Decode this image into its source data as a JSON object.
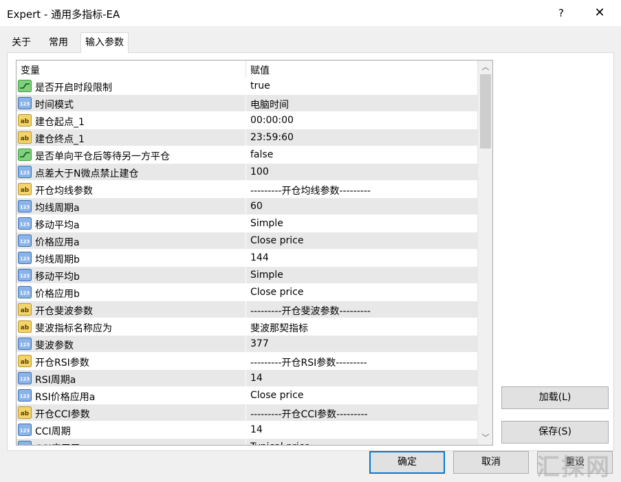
{
  "window": {
    "title": "Expert - 通用多指标-EA",
    "help_label": "?",
    "close_label": "✕"
  },
  "tabs": [
    {
      "label": "关于"
    },
    {
      "label": "常用"
    },
    {
      "label": "输入参数"
    }
  ],
  "grid": {
    "header_var": "变量",
    "header_val": "赋值",
    "rows": [
      {
        "type": "bool",
        "name": "是否开启时段限制",
        "value": "true"
      },
      {
        "type": "int",
        "name": "时间模式",
        "value": "电脑时间"
      },
      {
        "type": "str",
        "name": "建仓起点_1",
        "value": "00:00:00"
      },
      {
        "type": "str",
        "name": "建仓终点_1",
        "value": "23:59:60"
      },
      {
        "type": "bool",
        "name": "是否单向平仓后等待另一方平仓",
        "value": "false"
      },
      {
        "type": "int",
        "name": "点差大于N微点禁止建仓",
        "value": "100"
      },
      {
        "type": "str",
        "name": "开仓均线参数",
        "value": "---------开仓均线参数---------"
      },
      {
        "type": "int",
        "name": "均线周期a",
        "value": "60"
      },
      {
        "type": "int",
        "name": "移动平均a",
        "value": "Simple"
      },
      {
        "type": "int",
        "name": "价格应用a",
        "value": "Close price"
      },
      {
        "type": "int",
        "name": "均线周期b",
        "value": "144"
      },
      {
        "type": "int",
        "name": "移动平均b",
        "value": "Simple"
      },
      {
        "type": "int",
        "name": "价格应用b",
        "value": "Close price"
      },
      {
        "type": "str",
        "name": "开仓斐波参数",
        "value": "---------开仓斐波参数---------"
      },
      {
        "type": "str",
        "name": "斐波指标名称应为",
        "value": "斐波那契指标"
      },
      {
        "type": "int",
        "name": "斐波参数",
        "value": "377"
      },
      {
        "type": "str",
        "name": "开仓RSI参数",
        "value": "---------开仓RSI参数---------"
      },
      {
        "type": "int",
        "name": "RSI周期a",
        "value": "14"
      },
      {
        "type": "int",
        "name": "RSI价格应用a",
        "value": "Close price"
      },
      {
        "type": "str",
        "name": "开仓CCI参数",
        "value": "---------开仓CCI参数---------"
      },
      {
        "type": "int",
        "name": "CCI周期",
        "value": "14"
      },
      {
        "type": "int",
        "name": "CCI应用于",
        "value": "Typical price"
      }
    ]
  },
  "buttons": {
    "load": "加载(L)",
    "save": "保存(S)",
    "ok": "确定",
    "cancel": "取消",
    "reset": "重设"
  },
  "watermark": "汇探网",
  "icons": {
    "bool": "toggle-icon",
    "int": "number-icon",
    "str": "text-ab-icon"
  }
}
